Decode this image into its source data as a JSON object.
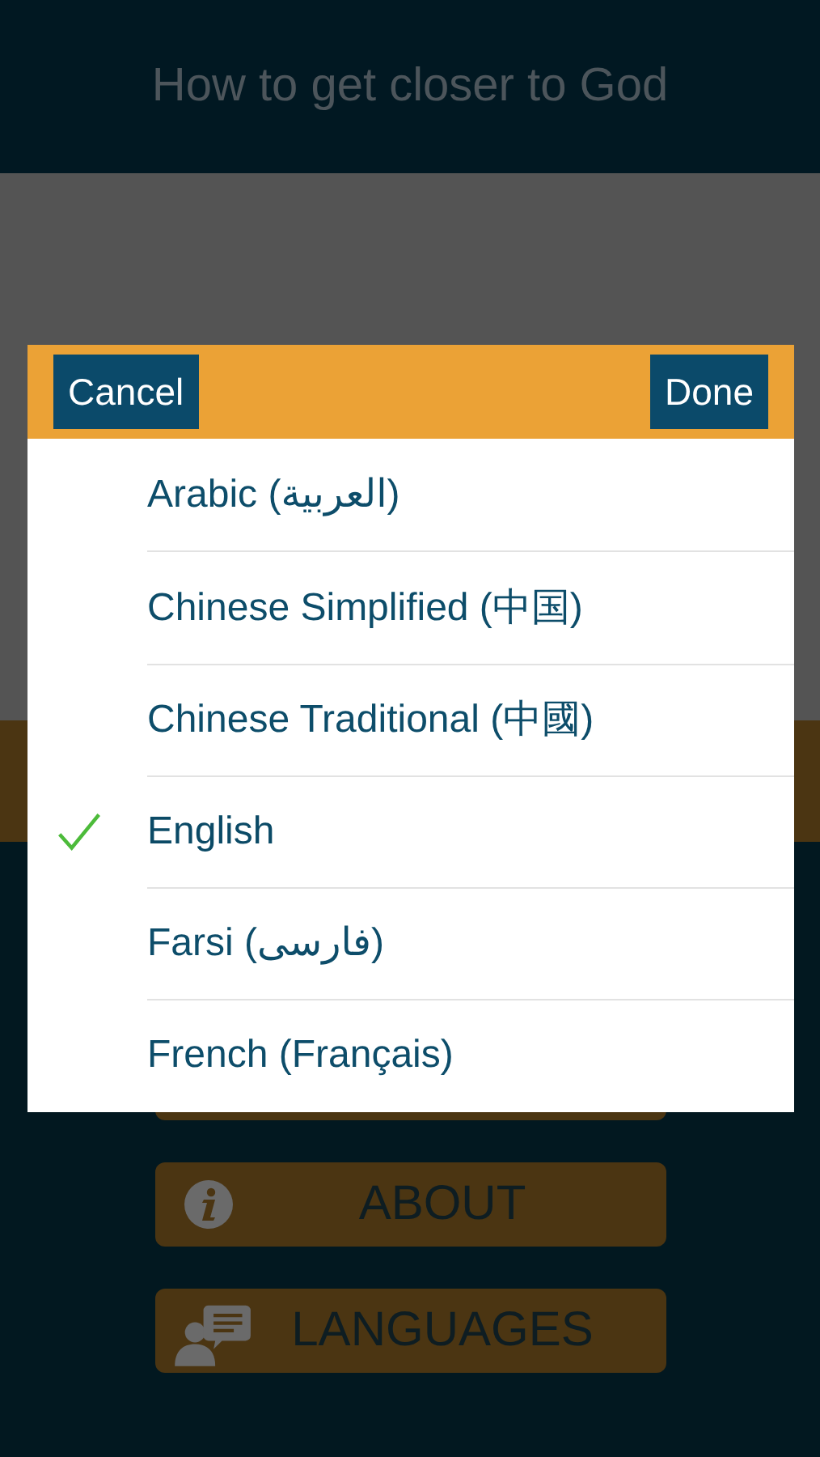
{
  "header": {
    "title": "How to get closer to God"
  },
  "menu": [
    {
      "kind": "hidden"
    },
    {
      "kind": "about",
      "label": "ABOUT"
    },
    {
      "kind": "languages",
      "label": "LANGUAGES"
    }
  ],
  "picker": {
    "cancel": "Cancel",
    "done": "Done",
    "options": [
      {
        "label": "Arabic (العربية)",
        "selected": false
      },
      {
        "label": "Chinese Simplified (中国)",
        "selected": false
      },
      {
        "label": "Chinese Traditional (中國)",
        "selected": false
      },
      {
        "label": "English",
        "selected": true
      },
      {
        "label": "Farsi (فارسی)",
        "selected": false
      },
      {
        "label": "French (Français)",
        "selected": false
      }
    ]
  }
}
